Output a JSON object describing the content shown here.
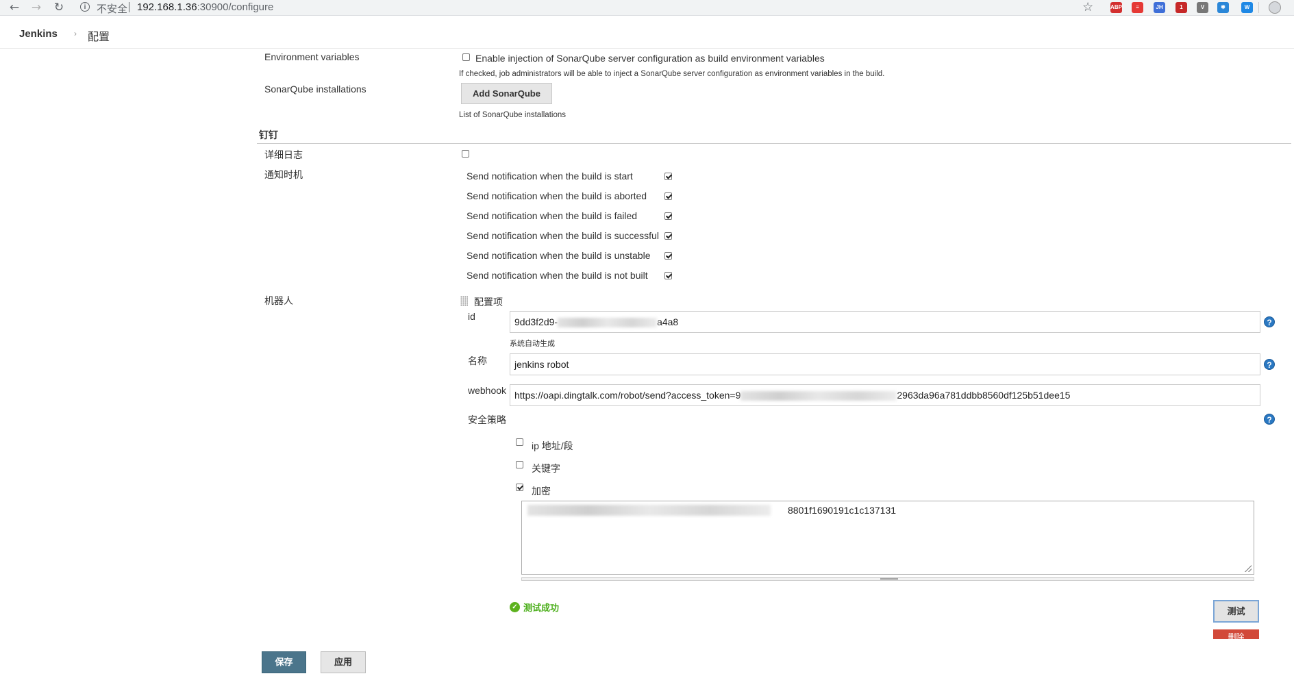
{
  "browser": {
    "security_label": "不安全",
    "url_host": "192.168.1.36",
    "url_path": ":30900/configure",
    "extensions": [
      {
        "label": "ABP",
        "color": "#d32f2f"
      },
      {
        "label": "≡",
        "color": "#e53935"
      },
      {
        "label": "JH",
        "color": "#3f6fd8"
      },
      {
        "label": "1",
        "color": "#c62828"
      },
      {
        "label": "V",
        "color": "#777777"
      },
      {
        "label": "✱",
        "color": "#2b87d8"
      },
      {
        "label": "W",
        "color": "#1e88e5"
      }
    ]
  },
  "breadcrumb": {
    "root": "Jenkins",
    "separator": "›",
    "current": "配置"
  },
  "env_vars": {
    "label": "Environment variables",
    "checkbox_label": "Enable injection of SonarQube server configuration as build environment variables",
    "description": "If checked, job administrators will be able to inject a SonarQube server configuration as environment variables in the build."
  },
  "sonar": {
    "label": "SonarQube installations",
    "button": "Add SonarQube",
    "description": "List of SonarQube installations"
  },
  "dingtalk": {
    "section_title": "钉钉",
    "verbose_log_label": "详细日志",
    "notify_label": "通知时机",
    "notifications": [
      {
        "label": "Send notification when the build is start",
        "checked": true
      },
      {
        "label": "Send notification when the build is aborted",
        "checked": true
      },
      {
        "label": "Send notification when the build is failed",
        "checked": true
      },
      {
        "label": "Send notification when the build is successful",
        "checked": true
      },
      {
        "label": "Send notification when the build is unstable",
        "checked": true
      },
      {
        "label": "Send notification when the build is not built",
        "checked": true
      }
    ],
    "robot_label": "机器人",
    "config_item_label": "配置项",
    "id_label": "id",
    "id_value_prefix": "9dd3f2d9-",
    "id_value_suffix": "a4a8",
    "id_hint": "系统自动生成",
    "name_label": "名称",
    "name_value": "jenkins robot",
    "webhook_label": "webhook",
    "webhook_prefix": "https://oapi.dingtalk.com/robot/send?access_token=9",
    "webhook_suffix": "2963da96a781ddbb8560df125b51dee15",
    "security_label": "安全策略",
    "security_options": [
      {
        "label": "ip 地址/段",
        "checked": false
      },
      {
        "label": "关键字",
        "checked": false
      },
      {
        "label": "加密",
        "checked": true
      }
    ],
    "secret_suffix": "8801f1690191c1c137131",
    "success_text": "测试成功",
    "test_button": "测试",
    "delete_button": "删除"
  },
  "footer": {
    "save": "保存",
    "apply": "应用"
  }
}
